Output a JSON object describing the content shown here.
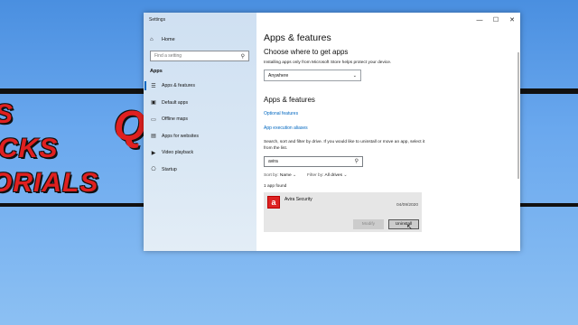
{
  "background": {
    "art_lines": [
      "S",
      "CKS",
      "ORIALS"
    ],
    "logo_glyph": "Q"
  },
  "window": {
    "title": "Settings",
    "controls": {
      "minimize": "—",
      "maximize": "☐",
      "close": "✕"
    }
  },
  "sidebar": {
    "home_label": "Home",
    "search_placeholder": "Find a setting",
    "section_label": "Apps",
    "items": [
      {
        "label": "Apps & features",
        "icon": "list-icon",
        "active": true
      },
      {
        "label": "Default apps",
        "icon": "default-apps-icon",
        "active": false
      },
      {
        "label": "Offline maps",
        "icon": "map-icon",
        "active": false
      },
      {
        "label": "Apps for websites",
        "icon": "web-icon",
        "active": false
      },
      {
        "label": "Video playback",
        "icon": "video-icon",
        "active": false
      },
      {
        "label": "Startup",
        "icon": "startup-icon",
        "active": false
      }
    ]
  },
  "main": {
    "title": "Apps & features",
    "choose_heading": "Choose where to get apps",
    "choose_desc": "Installing apps only from Microsoft Store helps protect your device.",
    "source_dropdown": "Anywhere",
    "apps_heading": "Apps & features",
    "link_optional": "Optional features",
    "link_aliases": "App execution aliases",
    "search_desc": "Search, sort and filter by drive. If you would like to uninstall or move an app, select it from the list.",
    "filter_value": "avira",
    "sort_label": "Sort by:",
    "sort_value": "Name",
    "filter_label": "Filter by:",
    "filter_drive_value": "All drives",
    "count_text": "1 app found",
    "app": {
      "name": "Avira Security",
      "date": "04/09/2020",
      "logo_glyph": "a"
    },
    "modify_label": "Modify",
    "uninstall_label": "Uninstall"
  },
  "colors": {
    "accent": "#0067c0",
    "avira_red": "#d22222"
  }
}
